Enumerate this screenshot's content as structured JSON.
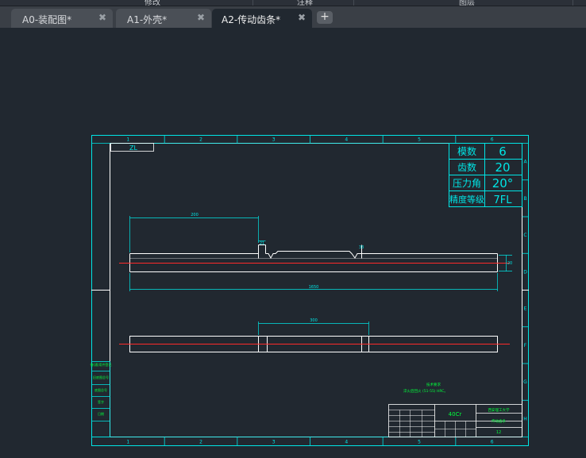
{
  "ribbon": {
    "sections": [
      "修改",
      "注释",
      "图层"
    ]
  },
  "tabs": [
    {
      "label": "A0-装配图*",
      "active": false
    },
    {
      "label": "A1-外壳*",
      "active": false
    },
    {
      "label": "A2-传动齿条*",
      "active": true
    }
  ],
  "new_tab_label": "+",
  "close_glyph": "✖",
  "drawing": {
    "colors": {
      "border": "#00e5e5",
      "geometry": "#ffffff",
      "centerline": "#ff2a2a",
      "annotation": "#00ff3c",
      "background": "#212830"
    },
    "zone_columns": [
      "1",
      "2",
      "3",
      "4",
      "5",
      "6"
    ],
    "zone_rows": [
      "A",
      "B",
      "C",
      "D",
      "E",
      "F",
      "G",
      "H"
    ],
    "corner_label": "ZL",
    "params_table": [
      {
        "name": "模数",
        "value": "6"
      },
      {
        "name": "齿数",
        "value": "20"
      },
      {
        "name": "压力角",
        "value": "20°"
      },
      {
        "name": "精度等级",
        "value": "7FL"
      }
    ],
    "dimensions": {
      "top_left_length": "200",
      "step_width": "21",
      "tooth_height": "33",
      "total_length": "1650",
      "section_height": "20",
      "bottom_length": "300"
    },
    "notes": {
      "title": "技术要求",
      "line": "淬火后回火 (51-55) HRC。"
    },
    "side_labels": [
      "借(通)用件登记",
      "旧底图总号",
      "底图总号",
      "签字",
      "日期"
    ],
    "title_block": {
      "material": "40Cr",
      "company": "西安理工大学",
      "part_name": "传动齿条",
      "sheet": "12"
    }
  }
}
